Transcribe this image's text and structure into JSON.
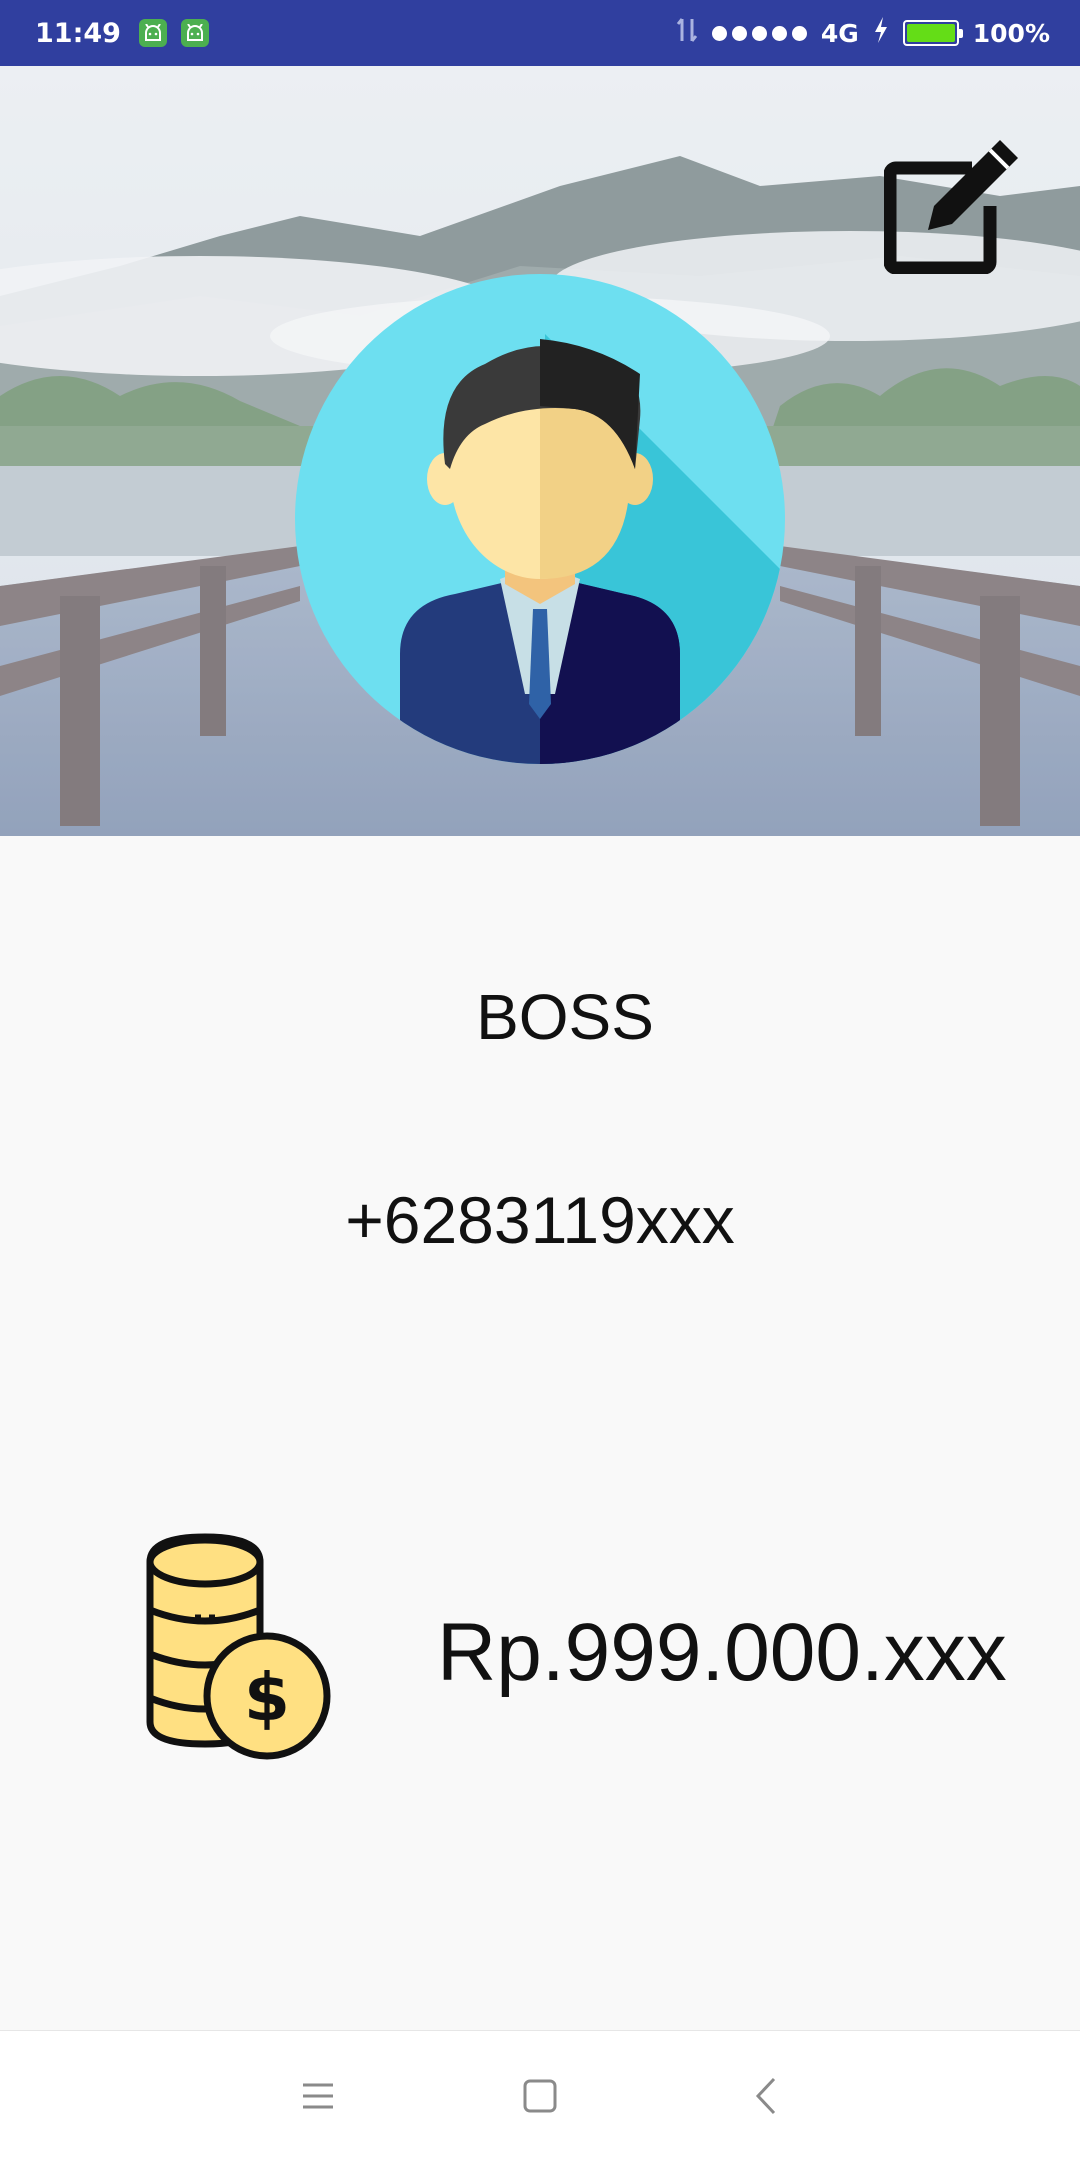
{
  "status_bar": {
    "time": "11:49",
    "network": "4G",
    "battery": "100%",
    "battery_level": 1.0,
    "notification_icons": [
      "android-icon",
      "android-icon"
    ]
  },
  "header": {
    "edit_icon": "edit-icon",
    "avatar_icon": "businessman-avatar-icon"
  },
  "profile": {
    "name": "BOSS",
    "phone": "+6283119xxx",
    "balance": "Rp.999.000.xxx",
    "balance_icon": "coins-dollar-icon"
  },
  "nav_bar": {
    "items": [
      "menu-icon",
      "home-icon",
      "back-icon"
    ]
  },
  "colors": {
    "status_bar": "#303f9f",
    "battery_fill": "#64dd17",
    "avatar_bg": "#6ddff0",
    "coin_fill": "#ffe082",
    "suit": "#233b7c"
  }
}
